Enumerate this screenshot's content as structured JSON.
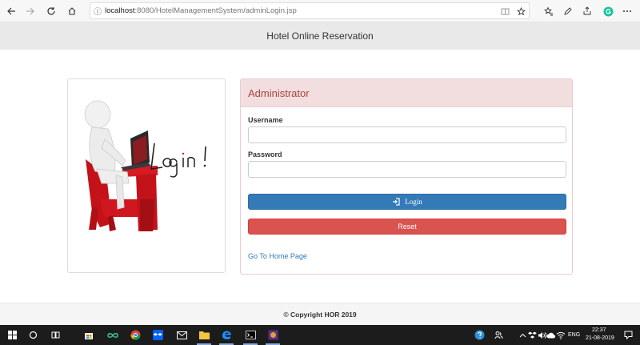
{
  "browser": {
    "url_host": "localhost",
    "url_rest": ":8080/HotelManagementSystem/adminLogin.jsp"
  },
  "header": {
    "title": "Hotel Online Reservation"
  },
  "illustration": {
    "text": "Login !"
  },
  "login": {
    "heading": "Administrator",
    "username_label": "Username",
    "username_value": "",
    "password_label": "Password",
    "password_value": "",
    "login_button": "Login",
    "reset_button": "Reset",
    "home_link": "Go To Home Page"
  },
  "footer": {
    "copyright": "© Copyright HOR 2019"
  },
  "taskbar": {
    "language": "ENG",
    "time": "22:37",
    "date": "21-08-2019"
  },
  "colors": {
    "primary": "#337ab7",
    "danger": "#d9534f",
    "heading_bg": "#f2dede",
    "heading_text": "#a94442"
  }
}
